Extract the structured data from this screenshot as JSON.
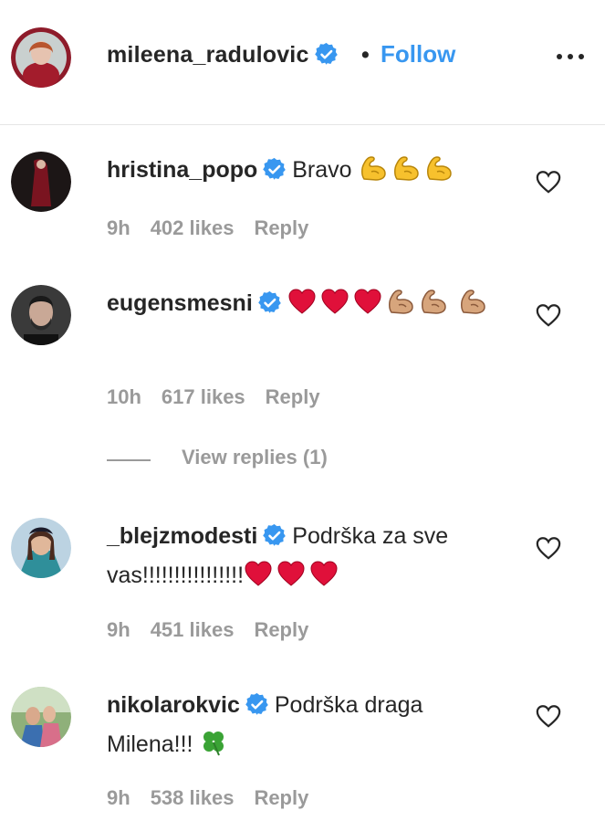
{
  "post_header": {
    "username": "mileena_radulovic",
    "separator": "•",
    "follow_label": "Follow"
  },
  "comments": [
    {
      "username": "hristina_popo",
      "text": "Bravo",
      "emojis": [
        "flexed-biceps-yellow",
        "flexed-biceps-yellow",
        "flexed-biceps-yellow"
      ],
      "time": "9h",
      "likes": "402 likes",
      "reply_label": "Reply"
    },
    {
      "username": "eugensmesni",
      "text": "",
      "emojis": [
        "red-heart",
        "red-heart",
        "red-heart",
        "flexed-biceps-tan",
        "flexed-biceps-tan",
        "flexed-biceps-tan"
      ],
      "time": "10h",
      "likes": "617 likes",
      "reply_label": "Reply",
      "view_replies": "View replies (1)"
    },
    {
      "username": "_blejzmodesti",
      "text": "Podrška za sve vas!!!!!!!!!!!!!!!!",
      "emojis": [
        "red-heart",
        "red-heart",
        "red-heart"
      ],
      "time": "9h",
      "likes": "451 likes",
      "reply_label": "Reply"
    },
    {
      "username": "nikolarokvic",
      "text": "Podrška draga Milena!!!",
      "emojis": [
        "four-leaf-clover"
      ],
      "time": "9h",
      "likes": "538 likes",
      "reply_label": "Reply"
    }
  ],
  "colors": {
    "link_blue": "#3897f0",
    "verified_blue": "#3897f0",
    "meta_gray": "#9a9a9a",
    "heart_red": "#e0103a"
  }
}
